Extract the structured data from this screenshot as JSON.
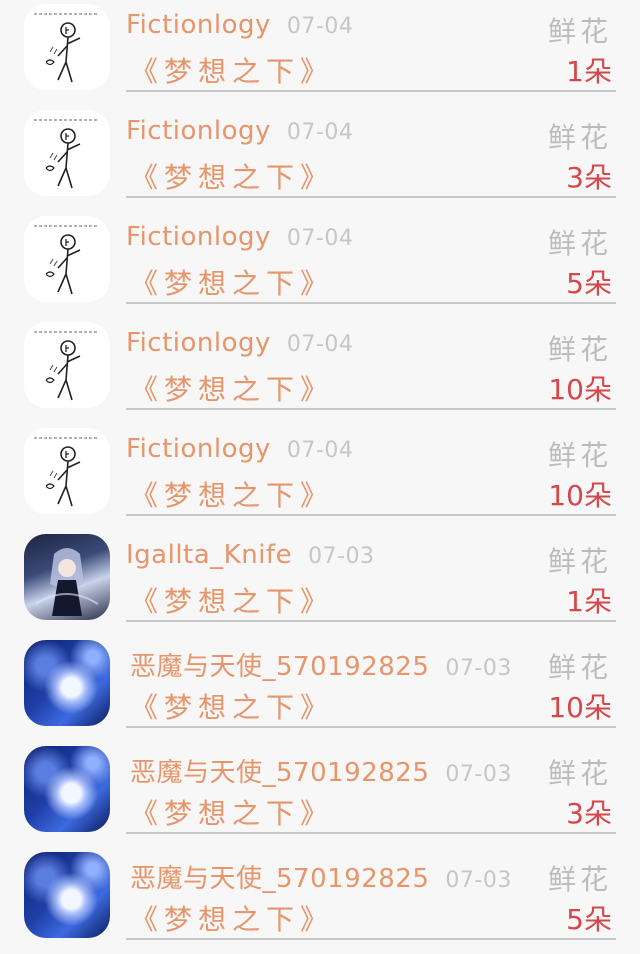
{
  "items": [
    {
      "user": "Fictionlogy",
      "date": "07-04",
      "work": "《梦想之下》",
      "gift": "鲜花",
      "count": "1朵",
      "avatar": "sketch-avatar"
    },
    {
      "user": "Fictionlogy",
      "date": "07-04",
      "work": "《梦想之下》",
      "gift": "鲜花",
      "count": "3朵",
      "avatar": "sketch-avatar"
    },
    {
      "user": "Fictionlogy",
      "date": "07-04",
      "work": "《梦想之下》",
      "gift": "鲜花",
      "count": "5朵",
      "avatar": "sketch-avatar"
    },
    {
      "user": "Fictionlogy",
      "date": "07-04",
      "work": "《梦想之下》",
      "gift": "鲜花",
      "count": "10朵",
      "avatar": "sketch-avatar"
    },
    {
      "user": "Fictionlogy",
      "date": "07-04",
      "work": "《梦想之下》",
      "gift": "鲜花",
      "count": "10朵",
      "avatar": "sketch-avatar"
    },
    {
      "user": "Igallta_Knife",
      "date": "07-03",
      "work": "《梦想之下》",
      "gift": "鲜花",
      "count": "1朵",
      "avatar": "anime-avatar"
    },
    {
      "user": "恶魔与天使_570192825",
      "date": "07-03",
      "work": "《梦想之下》",
      "gift": "鲜花",
      "count": "10朵",
      "avatar": "blue-art-avatar"
    },
    {
      "user": "恶魔与天使_570192825",
      "date": "07-03",
      "work": "《梦想之下》",
      "gift": "鲜花",
      "count": "3朵",
      "avatar": "blue-art-avatar"
    },
    {
      "user": "恶魔与天使_570192825",
      "date": "07-03",
      "work": "《梦想之下》",
      "gift": "鲜花",
      "count": "5朵",
      "avatar": "blue-art-avatar"
    }
  ]
}
